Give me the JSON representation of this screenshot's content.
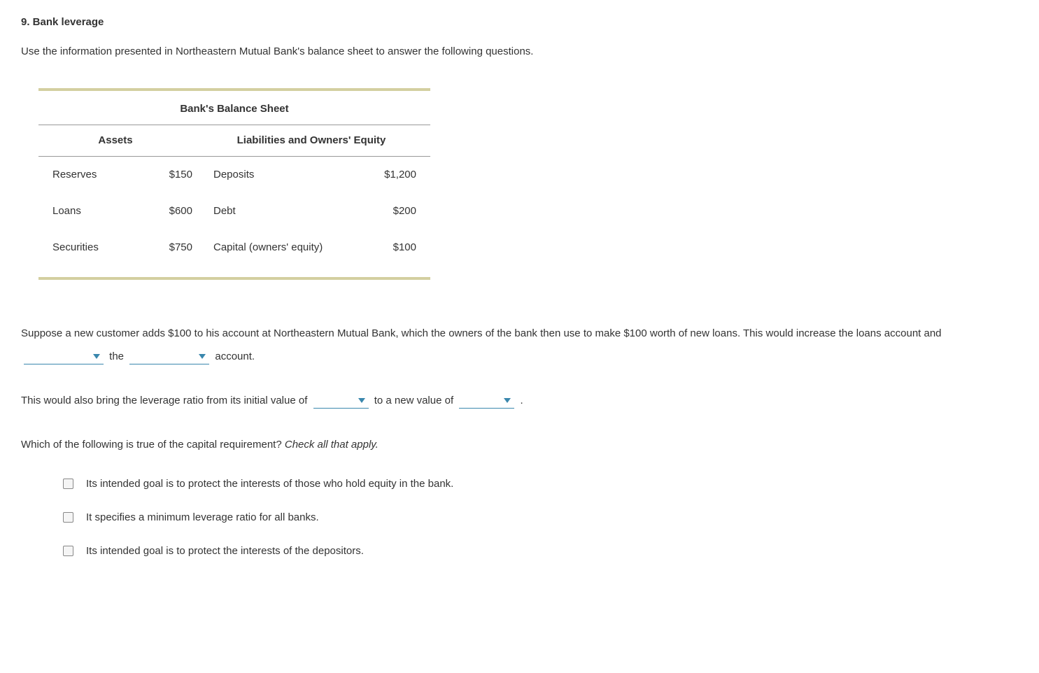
{
  "title": "9. Bank leverage",
  "intro": "Use the information presented in Northeastern Mutual Bank's balance sheet to answer the following questions.",
  "balance_sheet": {
    "title": "Bank's Balance Sheet",
    "header_assets": "Assets",
    "header_liab": "Liabilities and Owners' Equity",
    "rows": [
      {
        "asset_label": "Reserves",
        "asset_val": "$150",
        "liab_label": "Deposits",
        "liab_val": "$1,200"
      },
      {
        "asset_label": "Loans",
        "asset_val": "$600",
        "liab_label": "Debt",
        "liab_val": "$200"
      },
      {
        "asset_label": "Securities",
        "asset_val": "$750",
        "liab_label": "Capital (owners' equity)",
        "liab_val": "$100"
      }
    ]
  },
  "q1": {
    "pre": "Suppose a new customer adds $100 to his account at Northeastern Mutual Bank, which the owners of the bank then use to make $100 worth of new loans. This would increase the loans account and ",
    "mid1": " the ",
    "mid2": " account."
  },
  "q2": {
    "pre": "This would also bring the leverage ratio from its initial value of ",
    "mid": " to a new value of ",
    "post": " ."
  },
  "q3": {
    "prompt_plain": "Which of the following is true of the capital requirement? ",
    "prompt_italic": "Check all that apply.",
    "options": [
      "Its intended goal is to protect the interests of those who hold equity in the bank.",
      "It specifies a minimum leverage ratio for all banks.",
      "Its intended goal is to protect the interests of the depositors."
    ]
  }
}
